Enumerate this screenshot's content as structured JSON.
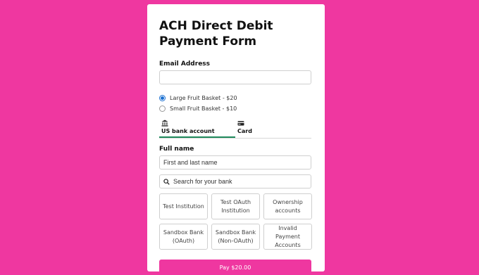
{
  "colors": {
    "background": "#ef37a0",
    "active_tab": "#1f8a5c",
    "radio": "#1a6fd1",
    "button": "#ef37a0"
  },
  "form": {
    "title": "ACH Direct Debit Payment Form",
    "email_label": "Email Address",
    "email_value": "",
    "options": [
      {
        "label": "Large Fruit Basket - $20",
        "selected": true
      },
      {
        "label": "Small Fruit Basket - $10",
        "selected": false
      }
    ]
  },
  "tabs": [
    {
      "label": "US bank account",
      "icon": "bank-icon",
      "active": true
    },
    {
      "label": "Card",
      "icon": "card-icon",
      "active": false
    }
  ],
  "bank_form": {
    "fullname_label": "Full name",
    "fullname_placeholder": "First and last name",
    "search_placeholder": "Search for your bank",
    "banks": [
      "Test Institution",
      "Test OAuth Institution",
      "Ownership accounts",
      "Sandbox Bank (OAuth)",
      "Sandbox Bank (Non-OAuth)",
      "Invalid Payment Accounts"
    ]
  },
  "pay_button": "Pay $20.00"
}
